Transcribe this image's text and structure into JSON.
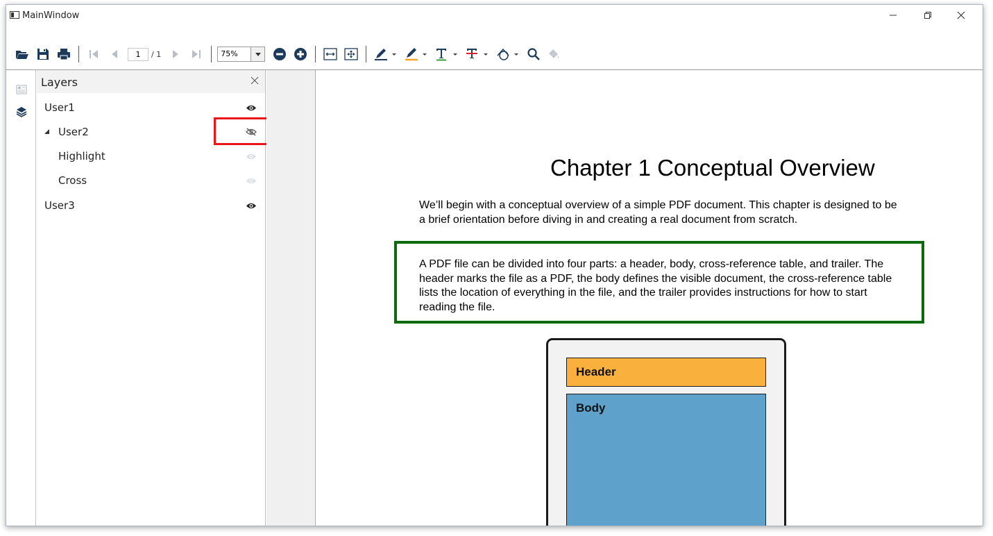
{
  "window": {
    "title": "MainWindow",
    "minimize_label": "—",
    "maximize_label": "❐",
    "close_label": "✕"
  },
  "toolbar": {
    "icons": [
      "open-folder-icon",
      "save-icon",
      "print-icon",
      "first-page-icon",
      "previous-page-icon",
      "next-page-icon",
      "last-page-icon",
      "zoom-out-icon",
      "zoom-in-icon",
      "fit-width-icon",
      "fit-page-icon",
      "ink-pen-icon",
      "highlighter-icon",
      "text-underline-icon",
      "text-strikethrough-icon",
      "shape-icon",
      "search-icon",
      "fill-bucket-icon"
    ],
    "current_page": "1",
    "total_pages": "/ 1",
    "zoom": "75%",
    "accent_colors": {
      "highlighter": "#f5a623",
      "underline": "#2e9e3a",
      "strikethrough": "#d9262c"
    }
  },
  "layers_panel": {
    "title": "Layers",
    "close_label": "✕",
    "layers": [
      {
        "label": "User1",
        "visible": true,
        "level": 0
      },
      {
        "label": "User2",
        "visible": false,
        "level": 0,
        "expanded": true
      },
      {
        "label": "Highlight",
        "visible": true,
        "level": 1,
        "dimmed": true
      },
      {
        "label": "Cross",
        "visible": true,
        "level": 1,
        "dimmed": true
      },
      {
        "label": "User3",
        "visible": true,
        "level": 0
      }
    ],
    "annotation_color": "#e8151b"
  },
  "document": {
    "chapter_title": "Chapter 1  Conceptual Overview",
    "paragraph1": "We’ll begin with a conceptual overview of a simple PDF document. This chapter is designed to be a brief orientation before diving in and creating a real document from scratch.",
    "paragraph2": "A PDF file can be divided into four parts: a header, body, cross-reference table, and trailer. The header marks the file as a PDF, the body defines the visible document, the cross-reference table lists the location of everything in the file, and the trailer provides instructions for how to start reading the file.",
    "paragraph2_box_color": "#0b6a0b",
    "diagram": {
      "header_label": "Header",
      "body_label": "Body",
      "header_color": "#f9b03d",
      "body_color": "#5ea2cc"
    }
  }
}
